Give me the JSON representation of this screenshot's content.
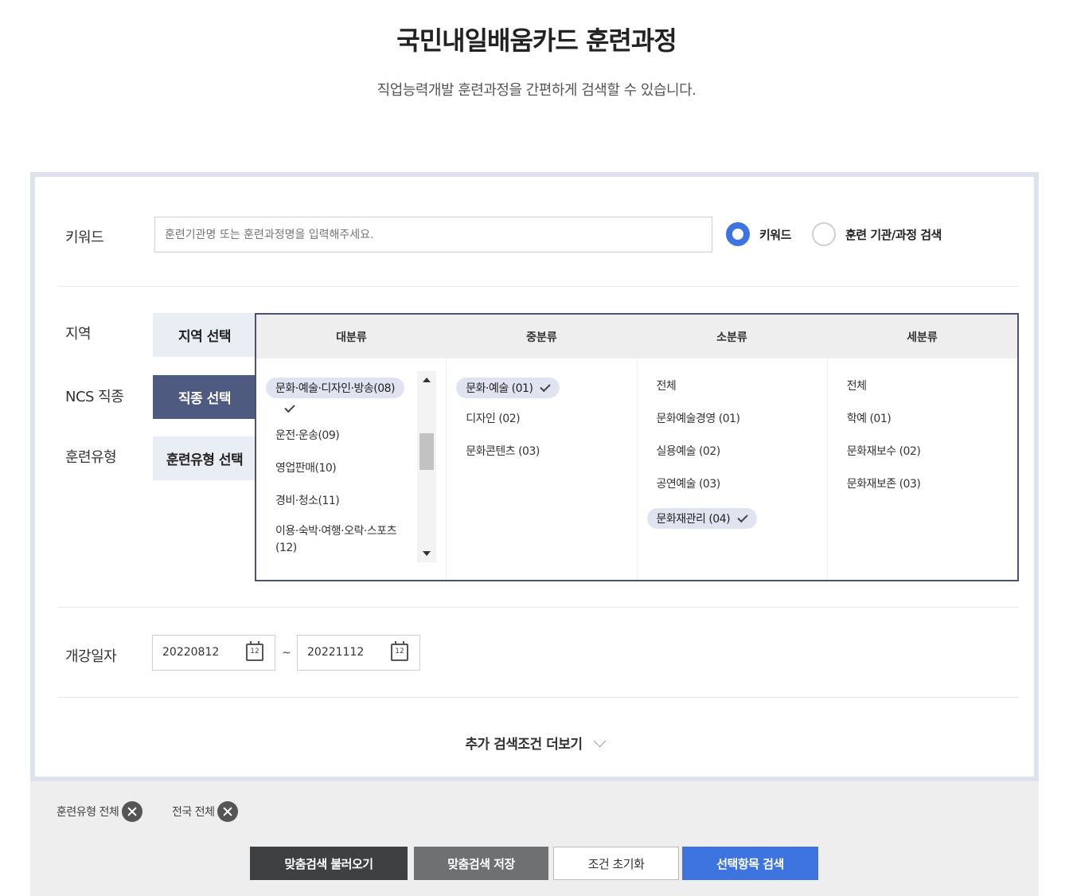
{
  "header": {
    "title": "국민내일배움카드 훈련과정",
    "subtitle": "직업능력개발 훈련과정을 간편하게 검색할 수 있습니다."
  },
  "keyword": {
    "label": "키워드",
    "placeholder": "훈련기관명 또는 훈련과정명을 입력해주세요.",
    "radio_options": [
      {
        "label": "키워드",
        "checked": true
      },
      {
        "label": "훈련 기관/과정 검색",
        "checked": false
      }
    ]
  },
  "filters": {
    "region": {
      "label": "지역",
      "button": "지역 선택"
    },
    "ncs": {
      "label": "NCS 직종",
      "button": "직종 선택"
    },
    "type": {
      "label": "훈련유형",
      "button": "훈련유형 선택"
    }
  },
  "categories": {
    "headers": [
      "대분류",
      "중분류",
      "소분류",
      "세분류"
    ],
    "major": [
      "문화·예술·디자인·방송(08)",
      "운전·운송(09)",
      "영업판매(10)",
      "경비·청소(11)",
      "이용·숙박·여행·오락·스포츠",
      "(12)"
    ],
    "middle": [
      "문화·예술 (01)",
      "디자인 (02)",
      "문화콘텐츠 (03)"
    ],
    "minor": [
      "전체",
      "문화예술경영 (01)",
      "실용예술 (02)",
      "공연예술 (03)",
      "문화재관리 (04)"
    ],
    "detail": [
      "전체",
      "학예 (01)",
      "문화재보수 (02)",
      "문화재보존 (03)"
    ]
  },
  "dates": {
    "label": "개강일자",
    "start": "20220812",
    "end": "20221112",
    "separator": "~",
    "calendar_icon_text": "12"
  },
  "more_label": "추가 검색조건 더보기",
  "tags": [
    "훈련유형 전체",
    "전국 전체"
  ],
  "buttons": {
    "load": "맞춤검색 불러오기",
    "save": "맞춤검색 저장",
    "reset": "조건 초기화",
    "search": "선택항목 검색"
  },
  "colors": {
    "accent": "#3d74e0",
    "active_tab": "#4f5a80",
    "dark_button": "#3f4042",
    "gray_button": "#6f7072"
  }
}
